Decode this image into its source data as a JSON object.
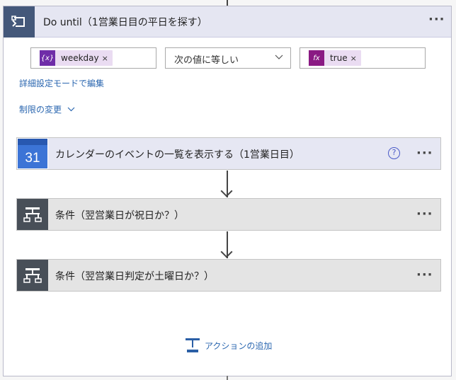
{
  "loop": {
    "title": "Do until（1営業日目の平日を探す）",
    "more_label": "···",
    "condition": {
      "left_token": {
        "icon": "variable-icon",
        "icon_text": "{x}",
        "label": "weekday",
        "remove": "×",
        "color": "#6f2da8"
      },
      "operator": "次の値に等しい",
      "right_token": {
        "icon": "expression-icon",
        "icon_text": "fx",
        "label": "true",
        "remove": "×",
        "color": "#8a1a83"
      }
    },
    "advanced_mode_link": "詳細設定モードで編集",
    "change_limits_link": "制限の変更"
  },
  "actions": [
    {
      "title": "カレンダーのイベントの一覧を表示する（1営業日目）",
      "icon": "google-calendar-icon",
      "icon_text": "31",
      "help": "?",
      "more": "···"
    },
    {
      "title": "条件（翌営業日が祝日か？）",
      "icon": "condition-icon",
      "more": "···"
    },
    {
      "title": "条件（翌営業日判定が土曜日か？）",
      "icon": "condition-icon",
      "more": "···"
    }
  ],
  "add_action_label": "アクションの追加",
  "colors": {
    "loop_header": "#e5e6f2",
    "loop_icon": "#44587a",
    "calendar_header": "#e6e7f3",
    "condition_bg": "#e4e4e4",
    "condition_icon": "#484f58",
    "link": "#2b67b0"
  }
}
